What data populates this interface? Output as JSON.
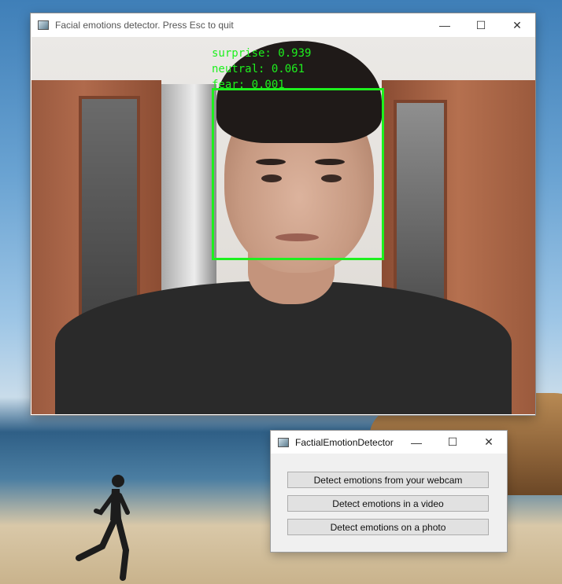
{
  "camera_window": {
    "title": "Facial emotions detector. Press Esc to quit",
    "controls": {
      "minimize": "—",
      "maximize": "☐",
      "close": "✕"
    },
    "emotions": [
      {
        "label": "surprise: 0.939"
      },
      {
        "label": "neutral: 0.061"
      },
      {
        "label": "fear: 0.001"
      }
    ],
    "face_box_color": "#1ef01e"
  },
  "dialog": {
    "title": "FactialEmotionDetector",
    "controls": {
      "minimize": "—",
      "maximize": "☐",
      "close": "✕"
    },
    "buttons": [
      {
        "label": "Detect emotions from your webcam"
      },
      {
        "label": "Detect emotions in a video"
      },
      {
        "label": "Detect emotions on a photo"
      }
    ]
  }
}
